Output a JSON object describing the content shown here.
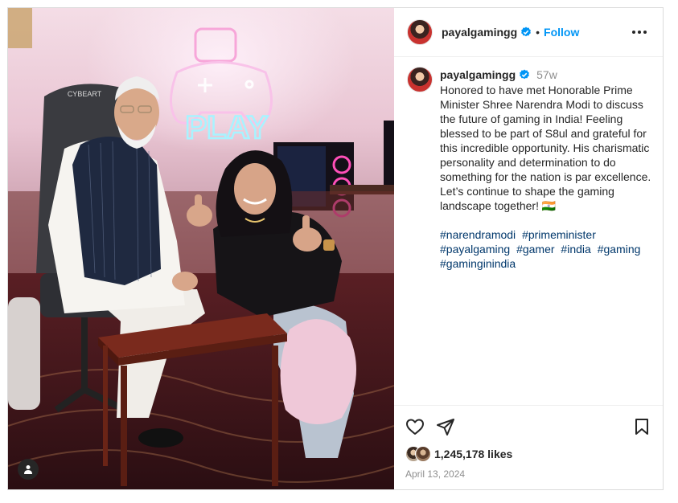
{
  "post": {
    "username": "payalgamingg",
    "header_separator": "•",
    "follow_label": "Follow",
    "caption": {
      "username": "payalgamingg",
      "age": "57w",
      "text": "Honored to have met Honorable Prime\nMinister Shree Narendra Modi to discuss\nthe future of gaming in India! Feeling\nblessed to be part of S8ul and grateful for\nthis incredible opportunity. His charismatic\npersonality and determination to do\nsomething for the nation is par excellence.\nLet’s continue to shape the gaming\nlandscape together! 🇮🇳",
      "hashtags": [
        "#narendramodi",
        "#primeminister",
        "#payalgaming",
        "#gamer",
        "#india",
        "#gaming",
        "#gaminginindia"
      ]
    },
    "photo": {
      "neon_sign": "PLAY",
      "chair_brand": "CYBEART"
    },
    "likes": "1,245,178 likes",
    "date": "April 13, 2024",
    "icons": {
      "verified": "verified-badge-icon",
      "more": "more-options-icon",
      "like": "heart-icon",
      "share": "share-icon",
      "save": "bookmark-icon",
      "tags": "user-tag-icon"
    },
    "colors": {
      "accent": "#0095f6",
      "verified": "#0095f6",
      "hashtag": "#00376b",
      "muted": "#8e8e8e"
    }
  }
}
